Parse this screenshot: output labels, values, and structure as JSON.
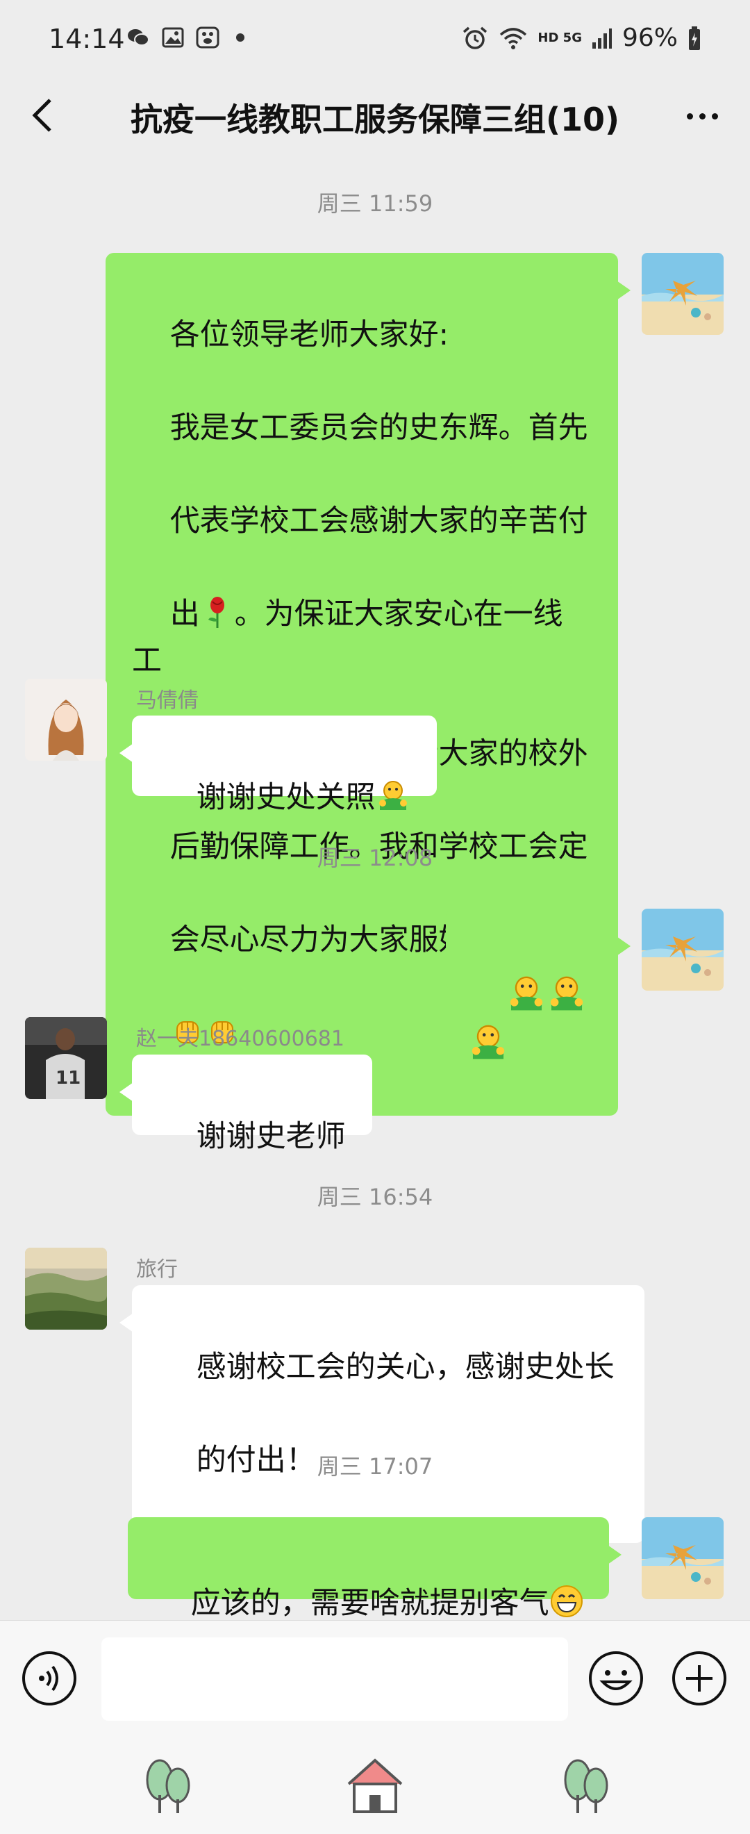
{
  "status_bar": {
    "time": "14:14",
    "network": "HD 5G",
    "battery": "96%"
  },
  "header": {
    "title": "抗疫一线教职工服务保障三组(10)"
  },
  "messages": {
    "ts1": "周三 11:59",
    "m1_lines": [
      "各位领导老师大家好:",
      "我是女工委员会的史东辉。首先",
      "代表学校工会感谢大家的辛苦付",
      "出",
      "。为保证大家安心在一线工",
      "作，今日起有我负责大家的校外",
      "后勤保障工作。我和学校工会定",
      "会尽心尽力为大家服好务"
    ],
    "m2_sender": "马倩倩",
    "m2_text": "谢谢史处关照",
    "ts2": "周三 12:08",
    "m4_sender": "赵一夫18640600681",
    "m4_text": "谢谢史老师",
    "ts3": "周三 16:54",
    "m5_sender": "旅行",
    "m5_line1": "感谢校工会的关心，感谢史处长",
    "m5_line2": "的付出！",
    "ts4": "周三 17:07",
    "m6_text": "应该的，需要啥就提别客气"
  },
  "icons": {
    "voice": "voice-icon",
    "emoji": "emoji-icon",
    "plus": "plus-icon",
    "back": "chevron-left-icon",
    "more": "more-icon"
  },
  "colors": {
    "mine_bubble": "#95ec69",
    "other_bubble": "#ffffff",
    "background": "#ededed"
  }
}
